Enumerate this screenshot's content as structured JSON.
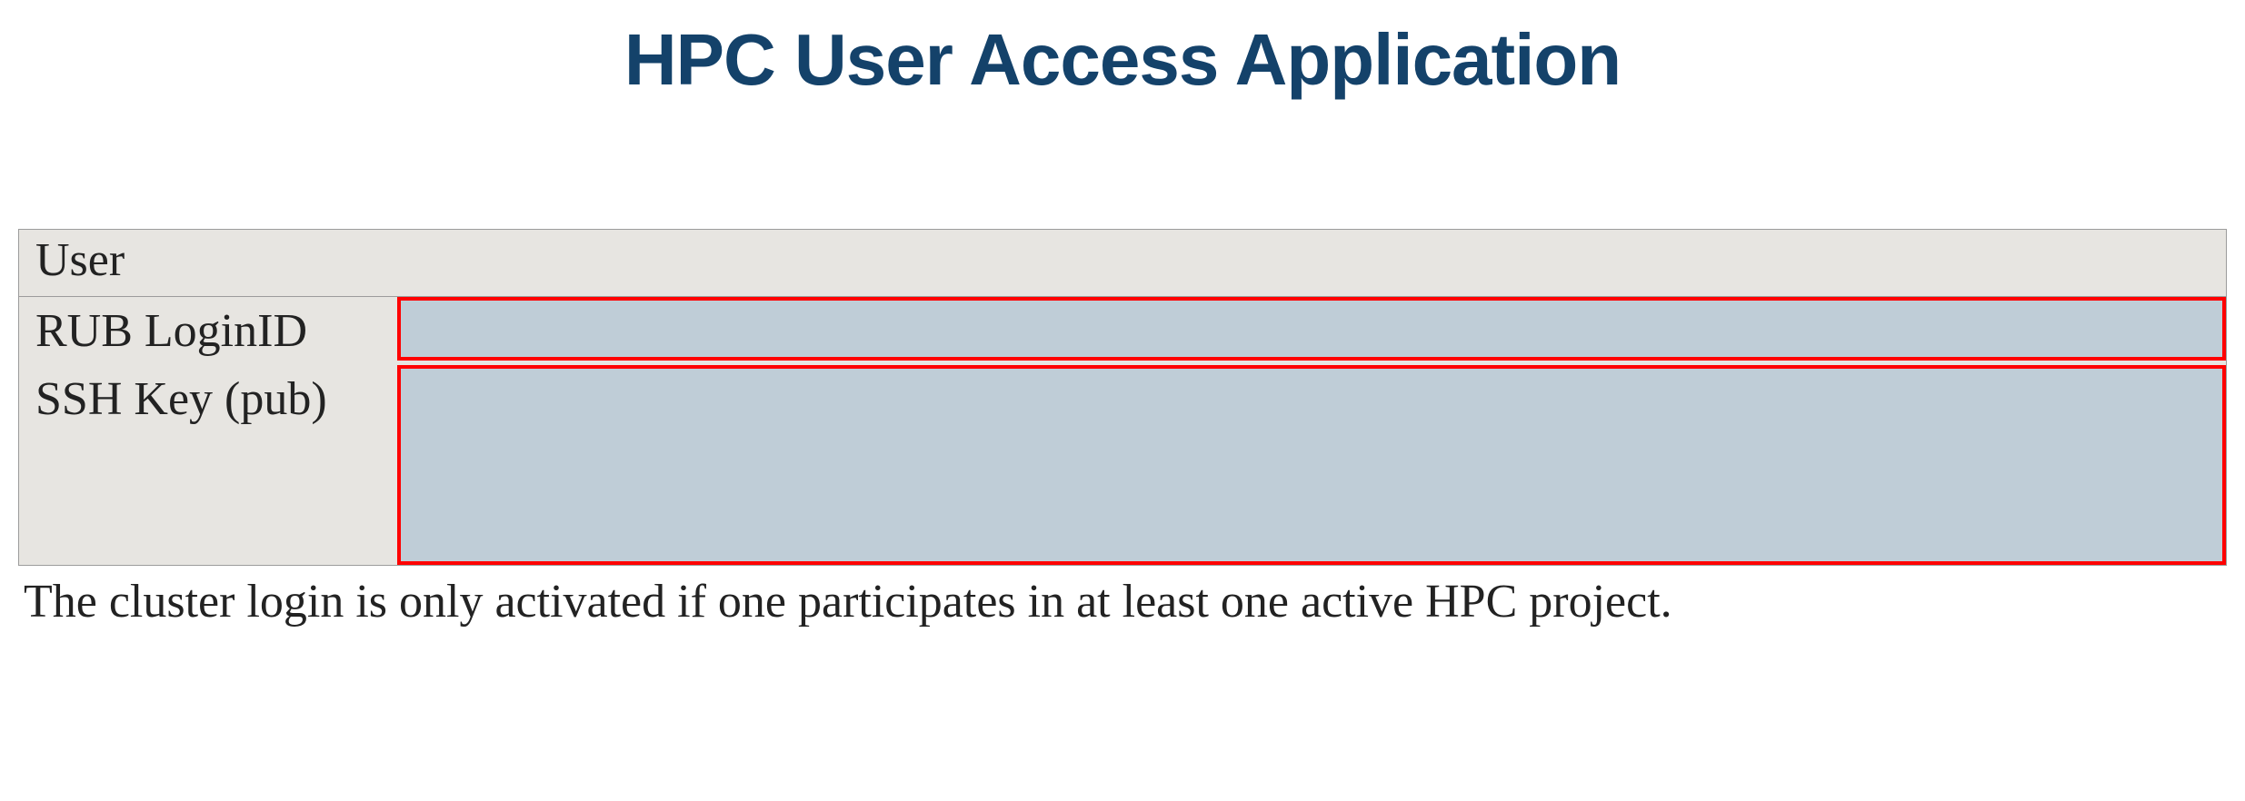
{
  "title": "HPC User Access Application",
  "form": {
    "section_header": "User",
    "fields": {
      "login_id": {
        "label": "RUB LoginID",
        "value": ""
      },
      "ssh_key": {
        "label": "SSH Key (pub)",
        "value": ""
      }
    }
  },
  "note": "The cluster login is only activated if one participates in at least one active HPC project."
}
